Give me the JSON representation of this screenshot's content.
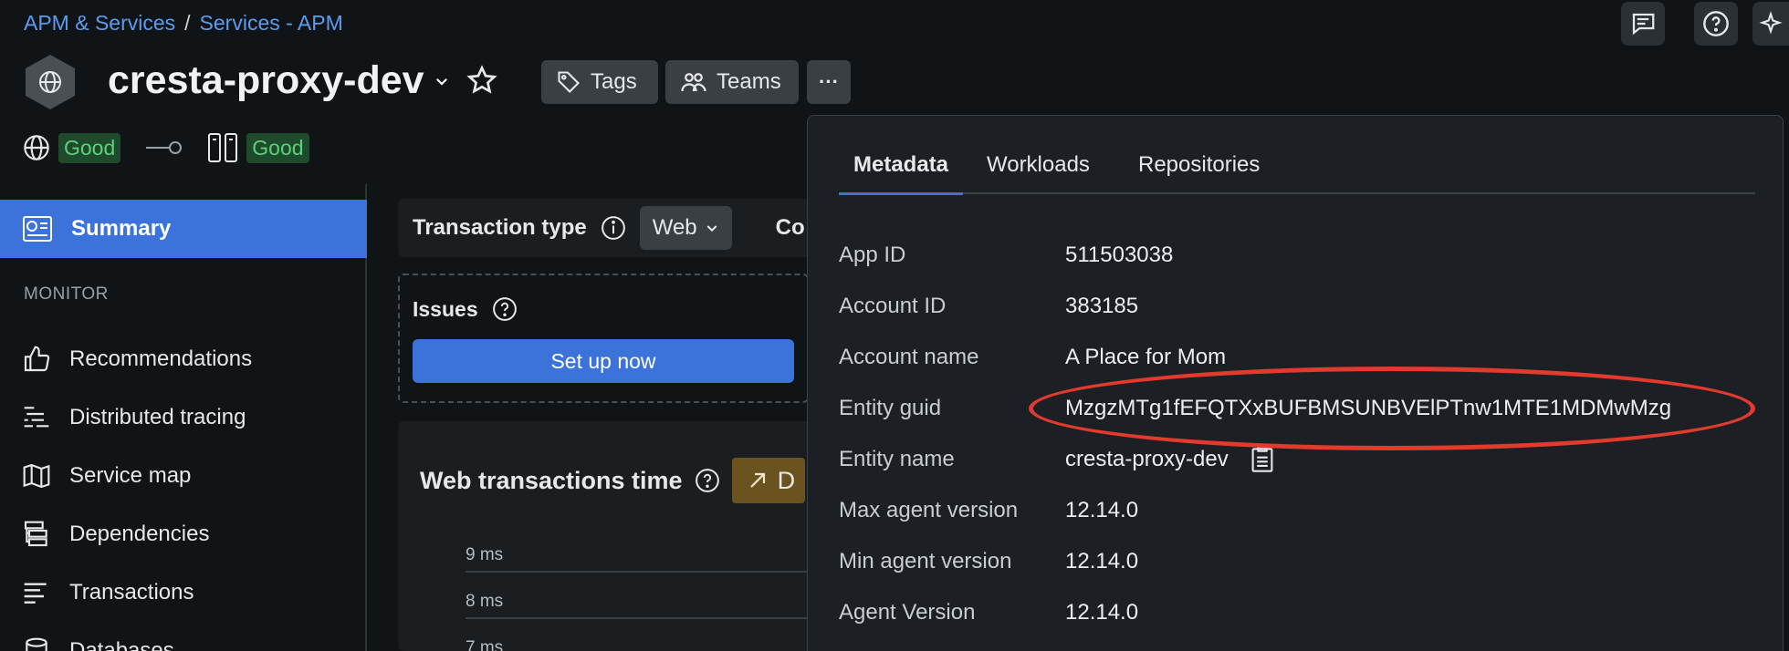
{
  "breadcrumb": {
    "parent": "APM & Services",
    "separator": "/",
    "current": "Services - APM"
  },
  "entity": {
    "title": "cresta-proxy-dev"
  },
  "actions": {
    "tags_label": "Tags",
    "teams_label": "Teams",
    "more_label": "···"
  },
  "status": {
    "service_health": "Good",
    "infra_health": "Good"
  },
  "sidebar": {
    "active_item": "Summary",
    "section_monitor": "MONITOR",
    "items": [
      "Recommendations",
      "Distributed tracing",
      "Service map",
      "Dependencies",
      "Transactions",
      "Databases"
    ]
  },
  "main": {
    "transaction_type_label": "Transaction type",
    "transaction_type_value": "Web",
    "cut_label": "Co",
    "issues_title": "Issues",
    "setup_button": "Set up now",
    "chart_title": "Web transactions time",
    "chart_button_letter": "D"
  },
  "chart_data": {
    "type": "line",
    "title": "Web transactions time",
    "y_ticks": [
      "9 ms",
      "8 ms",
      "7 ms"
    ],
    "series": []
  },
  "popover": {
    "tabs": [
      "Metadata",
      "Workloads",
      "Repositories"
    ],
    "active_tab": "Metadata",
    "rows": [
      {
        "key": "App ID",
        "value": "511503038"
      },
      {
        "key": "Account ID",
        "value": "383185"
      },
      {
        "key": "Account name",
        "value": "A Place for Mom"
      },
      {
        "key": "Entity guid",
        "value": "MzgzMTg1fEFQTXxBUFBMSUNBVElPTnw1MTE1MDMwMzg"
      },
      {
        "key": "Entity name",
        "value": "cresta-proxy-dev"
      },
      {
        "key": "Max agent version",
        "value": "12.14.0"
      },
      {
        "key": "Min agent version",
        "value": "12.14.0"
      },
      {
        "key": "Agent Version",
        "value": "12.14.0"
      }
    ]
  },
  "colors": {
    "accent": "#3b73db",
    "highlight": "#e23a2c",
    "good": "#5bd27a"
  }
}
